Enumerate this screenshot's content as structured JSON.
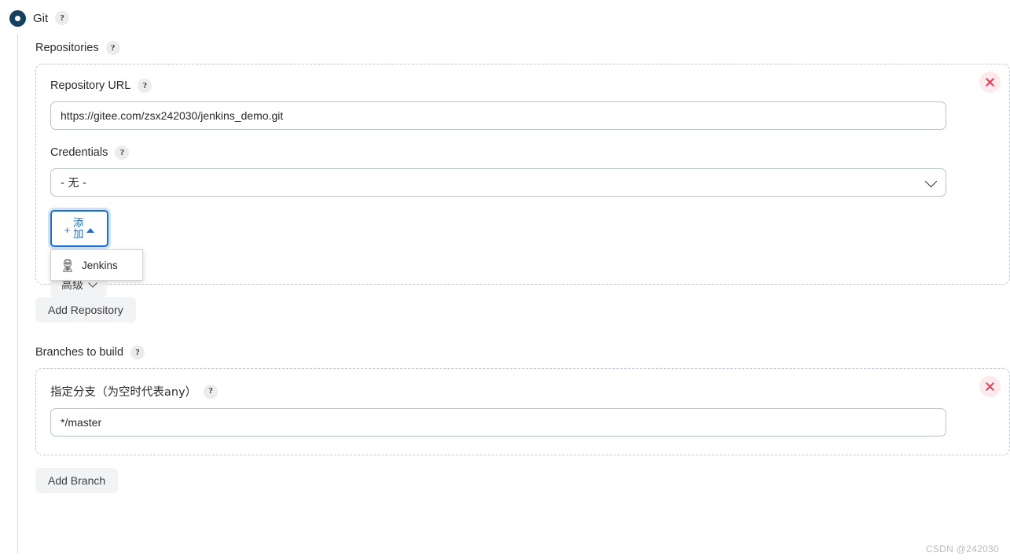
{
  "scm": {
    "radio_label": "Git",
    "radio_selected": true,
    "help_icon": "help-icon",
    "help_glyph": "?"
  },
  "repositories": {
    "section_label": "Repositories",
    "repo": {
      "url_label": "Repository URL",
      "url_value": "https://gitee.com/zsx242030/jenkins_demo.git",
      "credentials_label": "Credentials",
      "credentials_value": "- 无 -",
      "delete_title": "Delete repository",
      "delete_glyph": "✕",
      "add_credentials_button": "添加",
      "add_credentials_plus": "+",
      "advanced_button": "高级"
    },
    "dropdown": {
      "open": true,
      "items": [
        {
          "label": "Jenkins",
          "icon": "jenkins-butler-icon"
        }
      ]
    },
    "add_repository_button": "Add Repository"
  },
  "branches": {
    "section_label": "Branches to build",
    "branch": {
      "spec_label": "指定分支（为空时代表any）",
      "spec_value": "*/master",
      "delete_title": "Delete branch",
      "delete_glyph": "✕"
    },
    "add_branch_button": "Add Branch"
  },
  "watermark": "CSDN @242030",
  "colors": {
    "radio_fill": "#13415f",
    "accent_blue": "#1a6fd4",
    "focus_ring": "#cfe2f7",
    "delete_red": "#e8384f",
    "delete_bg": "#fdeaec",
    "dashed_border": "#c2cbd2",
    "input_border": "#b8c2c9",
    "grey_button_bg": "#f2f3f5"
  }
}
